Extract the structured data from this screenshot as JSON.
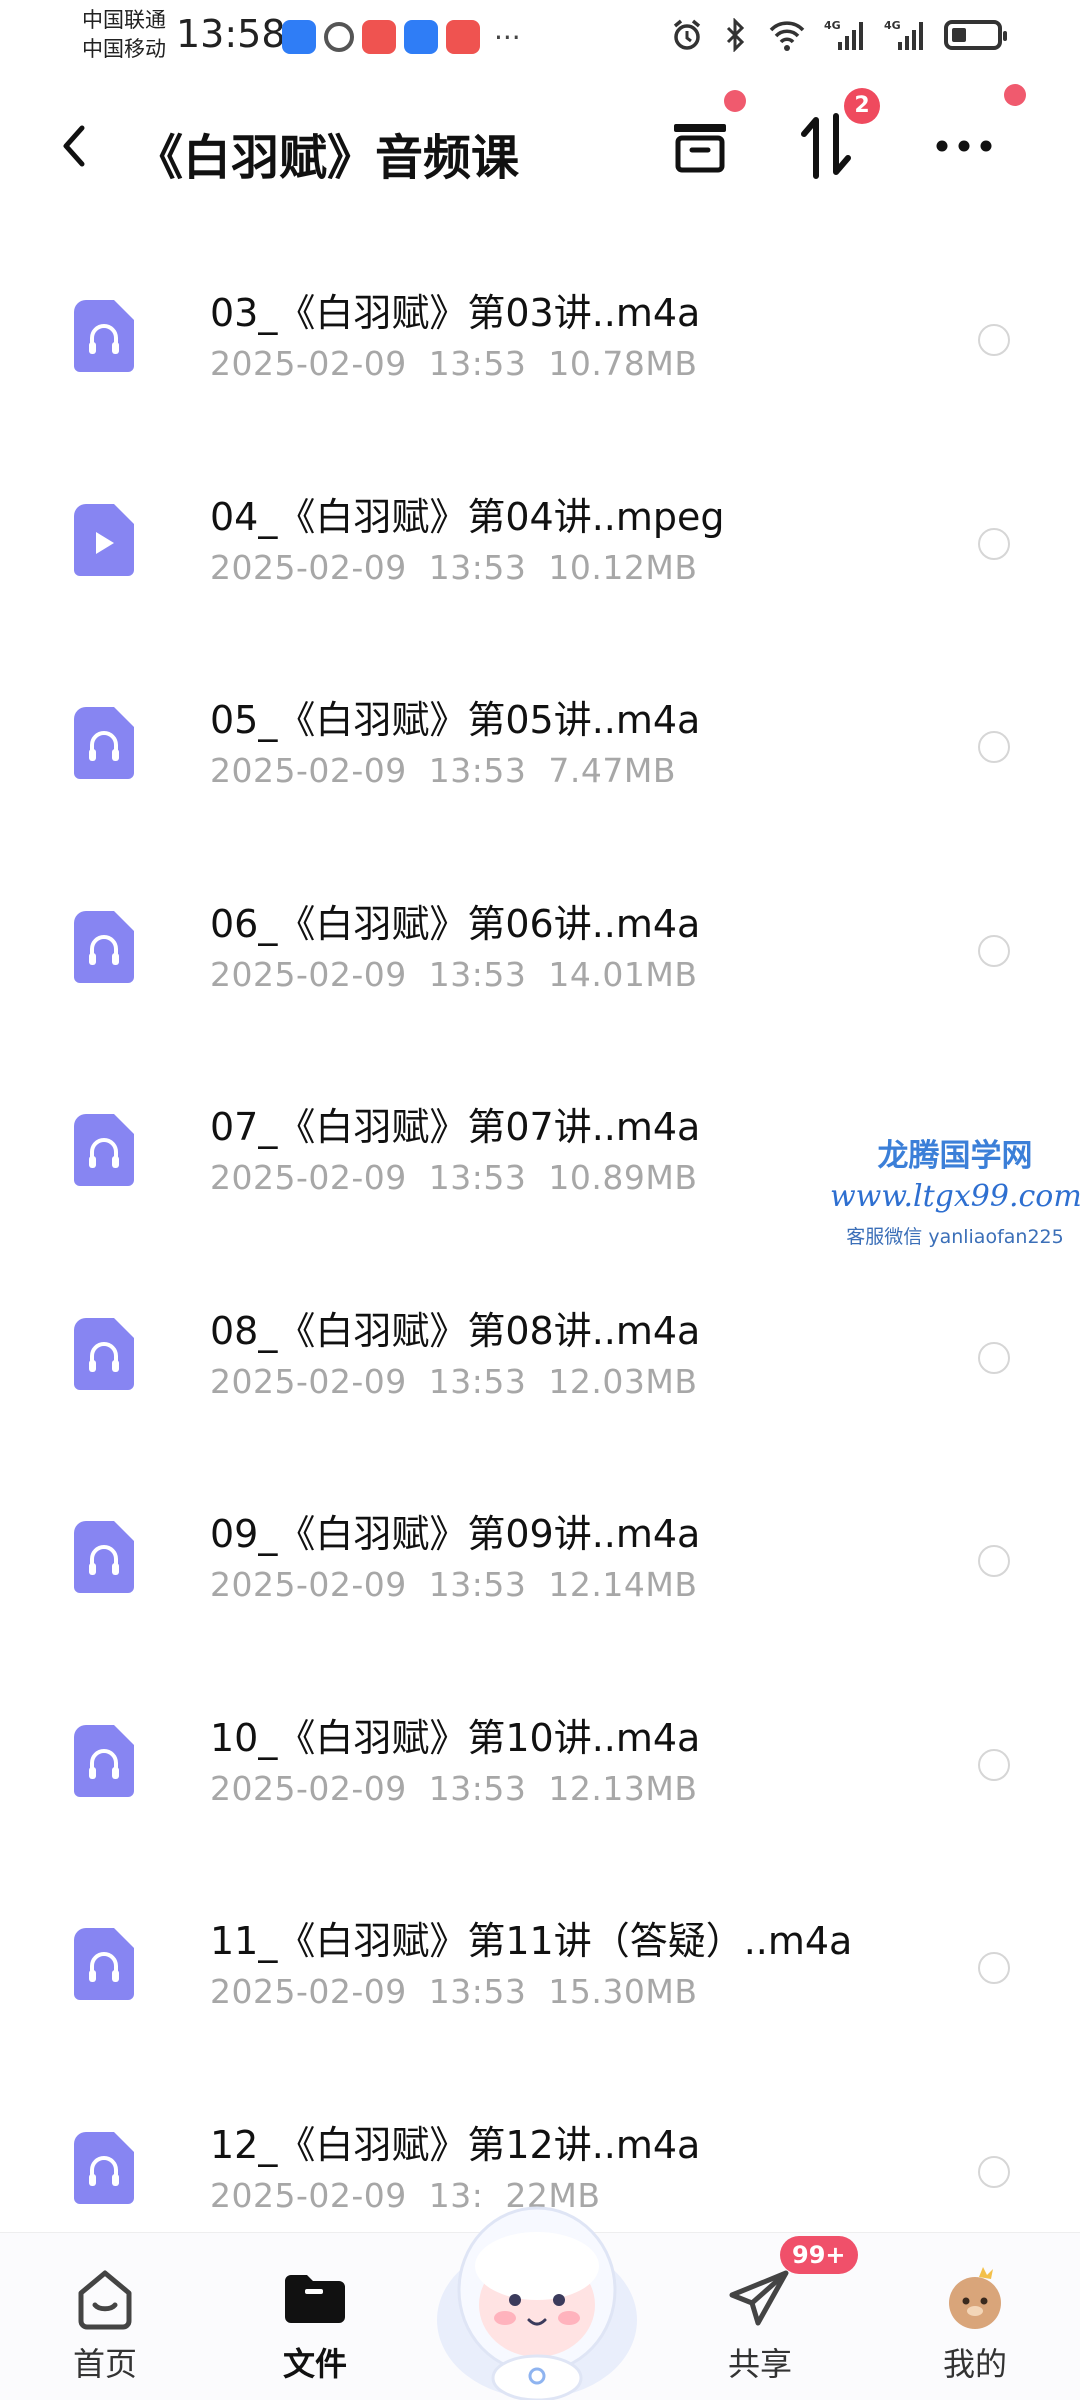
{
  "status_bar": {
    "carrier_1": "中国联通",
    "carrier_2": "中国移动",
    "time": "13:58",
    "more": "···",
    "icons": [
      "app-blue-icon",
      "app-gray-icon",
      "app-red-icon",
      "app-blue-icon",
      "app-red-icon",
      "alarm-icon",
      "bluetooth-icon",
      "wifi-icon",
      "signal-4g-icon",
      "signal-4g-icon",
      "battery-icon"
    ]
  },
  "header": {
    "title": "《白羽赋》音频课",
    "sort_badge": "2"
  },
  "files": [
    {
      "name": "03_《白羽赋》第03讲..m4a",
      "date": "2025-02-09",
      "time": "13:53",
      "size": "10.78MB",
      "type": "audio"
    },
    {
      "name": "04_《白羽赋》第04讲..mpeg",
      "date": "2025-02-09",
      "time": "13:53",
      "size": "10.12MB",
      "type": "video"
    },
    {
      "name": "05_《白羽赋》第05讲..m4a",
      "date": "2025-02-09",
      "time": "13:53",
      "size": "7.47MB",
      "type": "audio"
    },
    {
      "name": "06_《白羽赋》第06讲..m4a",
      "date": "2025-02-09",
      "time": "13:53",
      "size": "14.01MB",
      "type": "audio"
    },
    {
      "name": "07_《白羽赋》第07讲..m4a",
      "date": "2025-02-09",
      "time": "13:53",
      "size": "10.89MB",
      "type": "audio"
    },
    {
      "name": "08_《白羽赋》第08讲..m4a",
      "date": "2025-02-09",
      "time": "13:53",
      "size": "12.03MB",
      "type": "audio"
    },
    {
      "name": "09_《白羽赋》第09讲..m4a",
      "date": "2025-02-09",
      "time": "13:53",
      "size": "12.14MB",
      "type": "audio"
    },
    {
      "name": "10_《白羽赋》第10讲..m4a",
      "date": "2025-02-09",
      "time": "13:53",
      "size": "12.13MB",
      "type": "audio"
    },
    {
      "name": "11_《白羽赋》第11讲（答疑）..m4a",
      "date": "2025-02-09",
      "time": "13:53",
      "size": "15.30MB",
      "type": "audio"
    },
    {
      "name": "12_《白羽赋》第12讲..m4a",
      "date": "2025-02-09",
      "time": "13:",
      "size": "22MB",
      "type": "audio"
    }
  ],
  "watermark": {
    "title": "龙腾国学网",
    "url": "www.ltgx99.com",
    "contact": "客服微信 yanliaofan225"
  },
  "bottom_nav": {
    "home": "首页",
    "files": "文件",
    "share": "共享",
    "mine": "我的",
    "share_badge": "99+"
  },
  "colors": {
    "accent": "#7f7cf0",
    "badge": "#ef4a5e",
    "meta_text": "#a7a7a7"
  }
}
